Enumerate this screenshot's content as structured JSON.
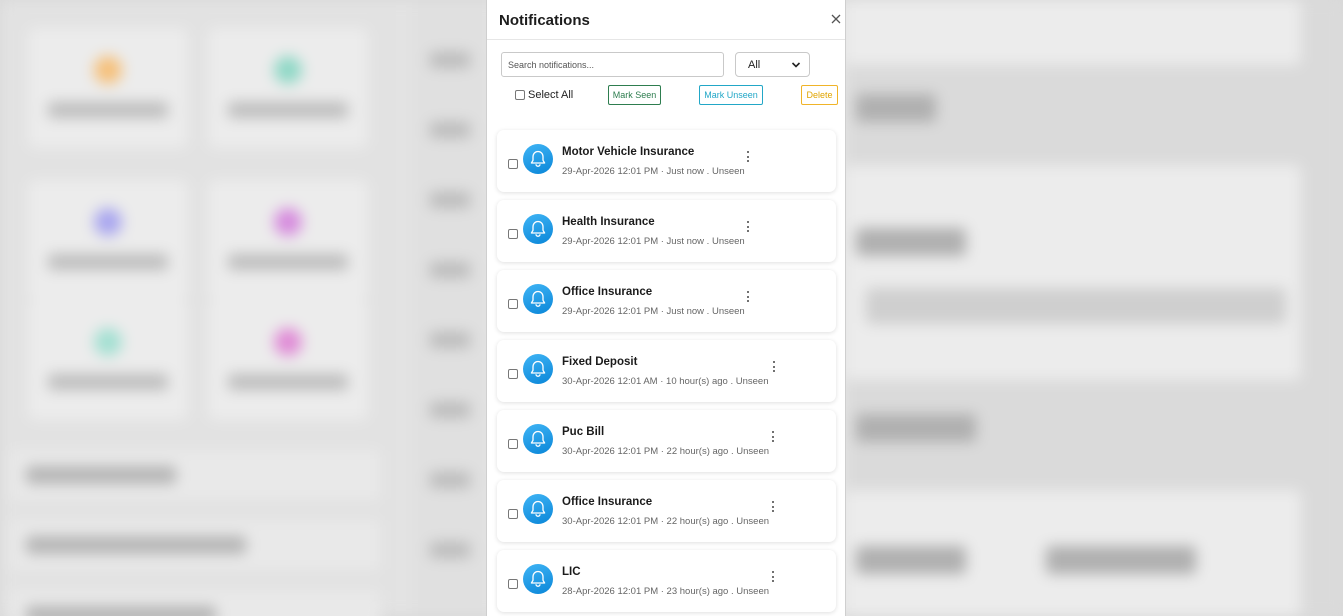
{
  "panel": {
    "title": "Notifications",
    "search_placeholder": "Search notifications...",
    "filter_value": "All",
    "select_all_label": "Select All",
    "buttons": {
      "mark_seen": "Mark Seen",
      "mark_unseen": "Mark Unseen",
      "delete": "Delete"
    },
    "colors": {
      "mark_seen": "#2e7d4f",
      "mark_unseen": "#22a7c7",
      "delete": "#f0b429",
      "avatar": "#1a9be6"
    }
  },
  "notifications": [
    {
      "title": "Motor Vehicle Insurance",
      "meta": "29-Apr-2026 12:01 PM · Just now . Unseen",
      "icon": "bell-icon"
    },
    {
      "title": "Health Insurance",
      "meta": "29-Apr-2026 12:01 PM · Just now . Unseen",
      "icon": "bell-icon"
    },
    {
      "title": "Office Insurance",
      "meta": "29-Apr-2026 12:01 PM · Just now . Unseen",
      "icon": "bell-icon"
    },
    {
      "title": "Fixed Deposit",
      "meta": "30-Apr-2026 12:01 AM · 10 hour(s) ago . Unseen",
      "icon": "bell-icon"
    },
    {
      "title": "Puc Bill",
      "meta": "30-Apr-2026 12:01 PM · 22 hour(s) ago . Unseen",
      "icon": "bell-icon"
    },
    {
      "title": "Office Insurance",
      "meta": "30-Apr-2026 12:01 PM · 22 hour(s) ago . Unseen",
      "icon": "bell-icon"
    },
    {
      "title": "LIC",
      "meta": "28-Apr-2026 12:01 PM · 23 hour(s) ago . Unseen",
      "icon": "bell-icon"
    }
  ]
}
